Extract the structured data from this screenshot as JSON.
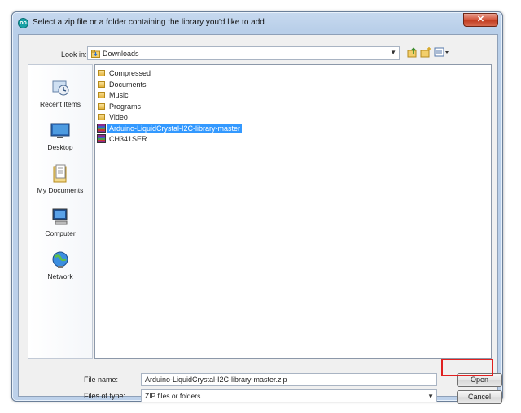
{
  "window": {
    "title": "Select a zip file or a folder containing the library you'd like to add",
    "app_icon_text": "oo",
    "close_symbol": "✕"
  },
  "toolbar": {
    "look_in_label": "Look in:",
    "look_in_value": "Downloads",
    "icons": [
      "up-folder-icon",
      "new-folder-icon",
      "view-menu-icon"
    ]
  },
  "places": [
    {
      "label": "Recent Items",
      "icon": "recent-items-icon"
    },
    {
      "label": "Desktop",
      "icon": "desktop-icon"
    },
    {
      "label": "My Documents",
      "icon": "my-documents-icon"
    },
    {
      "label": "Computer",
      "icon": "computer-icon"
    },
    {
      "label": "Network",
      "icon": "network-icon"
    }
  ],
  "files": [
    {
      "name": "Compressed",
      "kind": "folder"
    },
    {
      "name": "Documents",
      "kind": "folder"
    },
    {
      "name": "Music",
      "kind": "folder"
    },
    {
      "name": "Programs",
      "kind": "folder"
    },
    {
      "name": "Video",
      "kind": "folder"
    },
    {
      "name": "Arduino-LiquidCrystal-I2C-library-master",
      "kind": "zip",
      "selected": true
    },
    {
      "name": "CH341SER",
      "kind": "zip"
    }
  ],
  "form": {
    "file_name_label": "File name:",
    "file_name_value": "Arduino-LiquidCrystal-I2C-library-master.zip",
    "file_type_label": "Files of type:",
    "file_type_value": "ZIP files or folders"
  },
  "buttons": {
    "open": "Open",
    "cancel": "Cancel"
  },
  "colors": {
    "selection": "#3399ff",
    "highlight_box": "#e02020"
  }
}
